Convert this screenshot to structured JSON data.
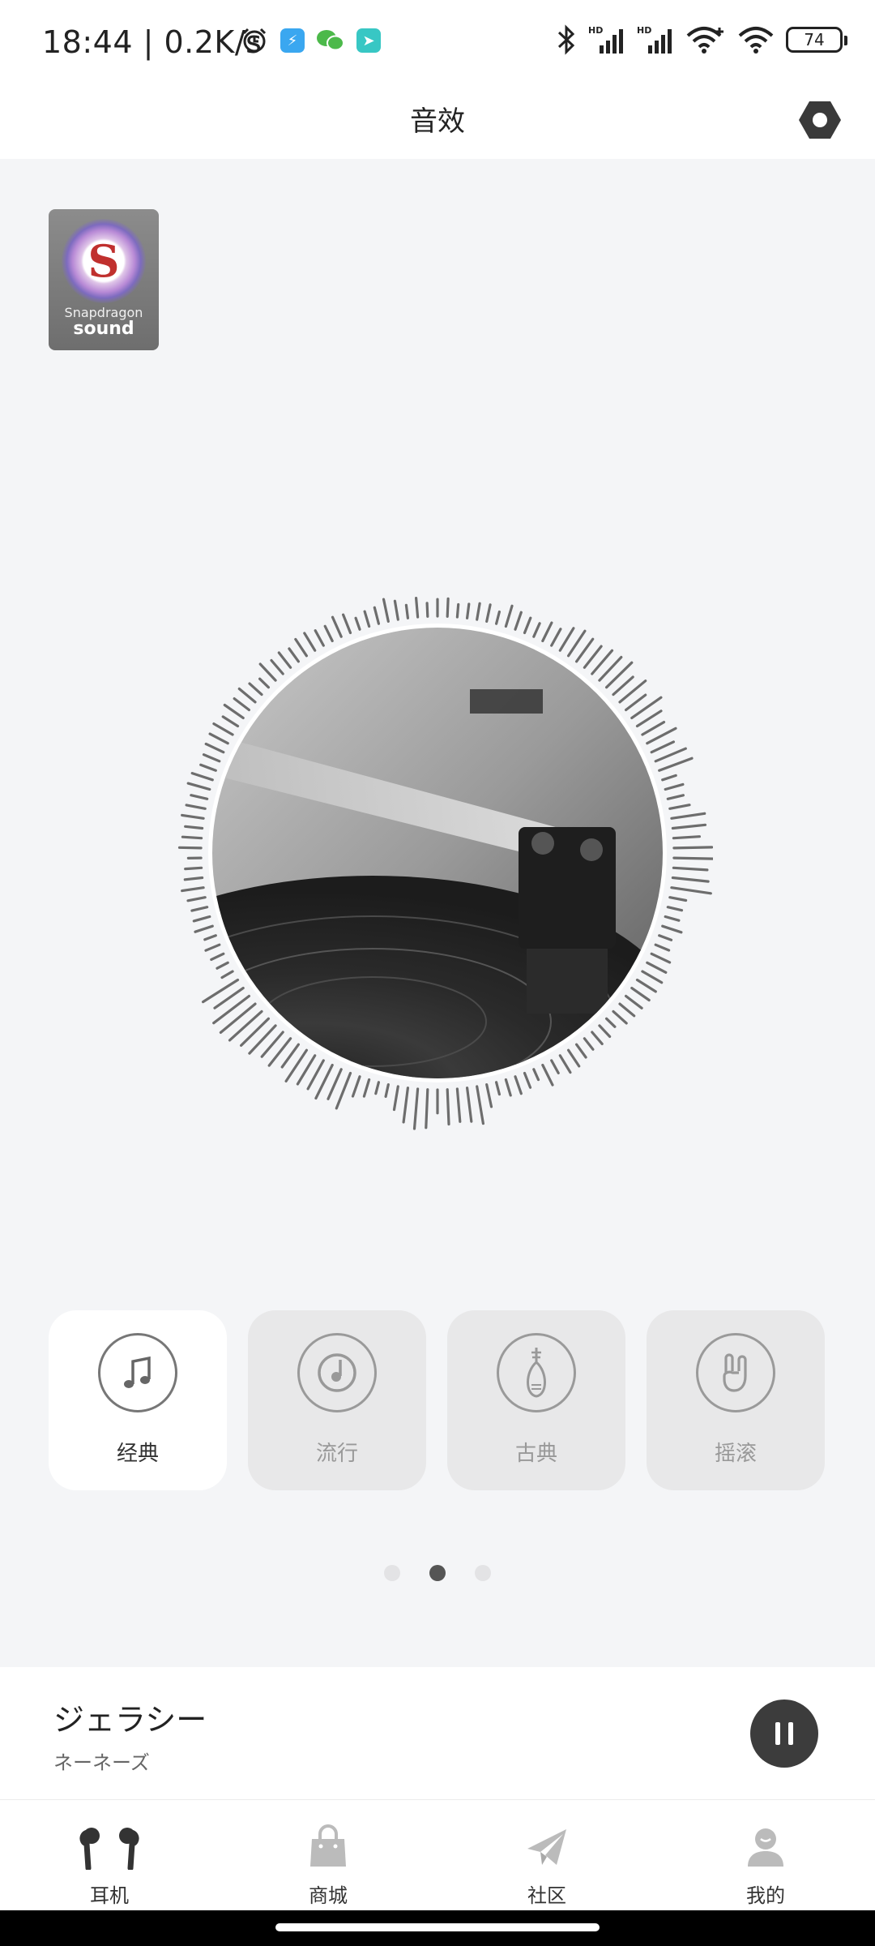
{
  "status_bar": {
    "time": "18:44 | 0.2K/s",
    "battery": "74",
    "left_icons": [
      "alarm-icon",
      "app-notification-icon",
      "wechat-icon",
      "navigation-app-icon"
    ],
    "right_icons": [
      "bluetooth-icon",
      "signal-hd-icon",
      "signal-hd-icon",
      "wifi-icon",
      "hotspot-icon",
      "battery-icon"
    ],
    "colors": {
      "app1": "#3aa7f0",
      "wechat": "#4cb94a",
      "app3": "#38c7c4"
    }
  },
  "header": {
    "title": "音效",
    "settings_icon": "settings-hexagon-icon"
  },
  "badge": {
    "line1": "Snapdragon",
    "line2": "sound"
  },
  "presets": [
    {
      "label": "经典",
      "icon": "music-note-icon",
      "active": true
    },
    {
      "label": "流行",
      "icon": "record-note-icon",
      "active": false
    },
    {
      "label": "古典",
      "icon": "pipa-instrument-icon",
      "active": false
    },
    {
      "label": "摇滚",
      "icon": "rock-hand-icon",
      "active": false
    }
  ],
  "pager": {
    "pages": 3,
    "current": 2
  },
  "now_playing": {
    "title": "ジェラシー",
    "artist": "ネーネーズ",
    "state": "playing"
  },
  "tabs": [
    {
      "label": "耳机",
      "icon": "earbuds-icon"
    },
    {
      "label": "商城",
      "icon": "shopping-bag-icon"
    },
    {
      "label": "社区",
      "icon": "paper-plane-icon"
    },
    {
      "label": "我的",
      "icon": "profile-icon"
    }
  ]
}
